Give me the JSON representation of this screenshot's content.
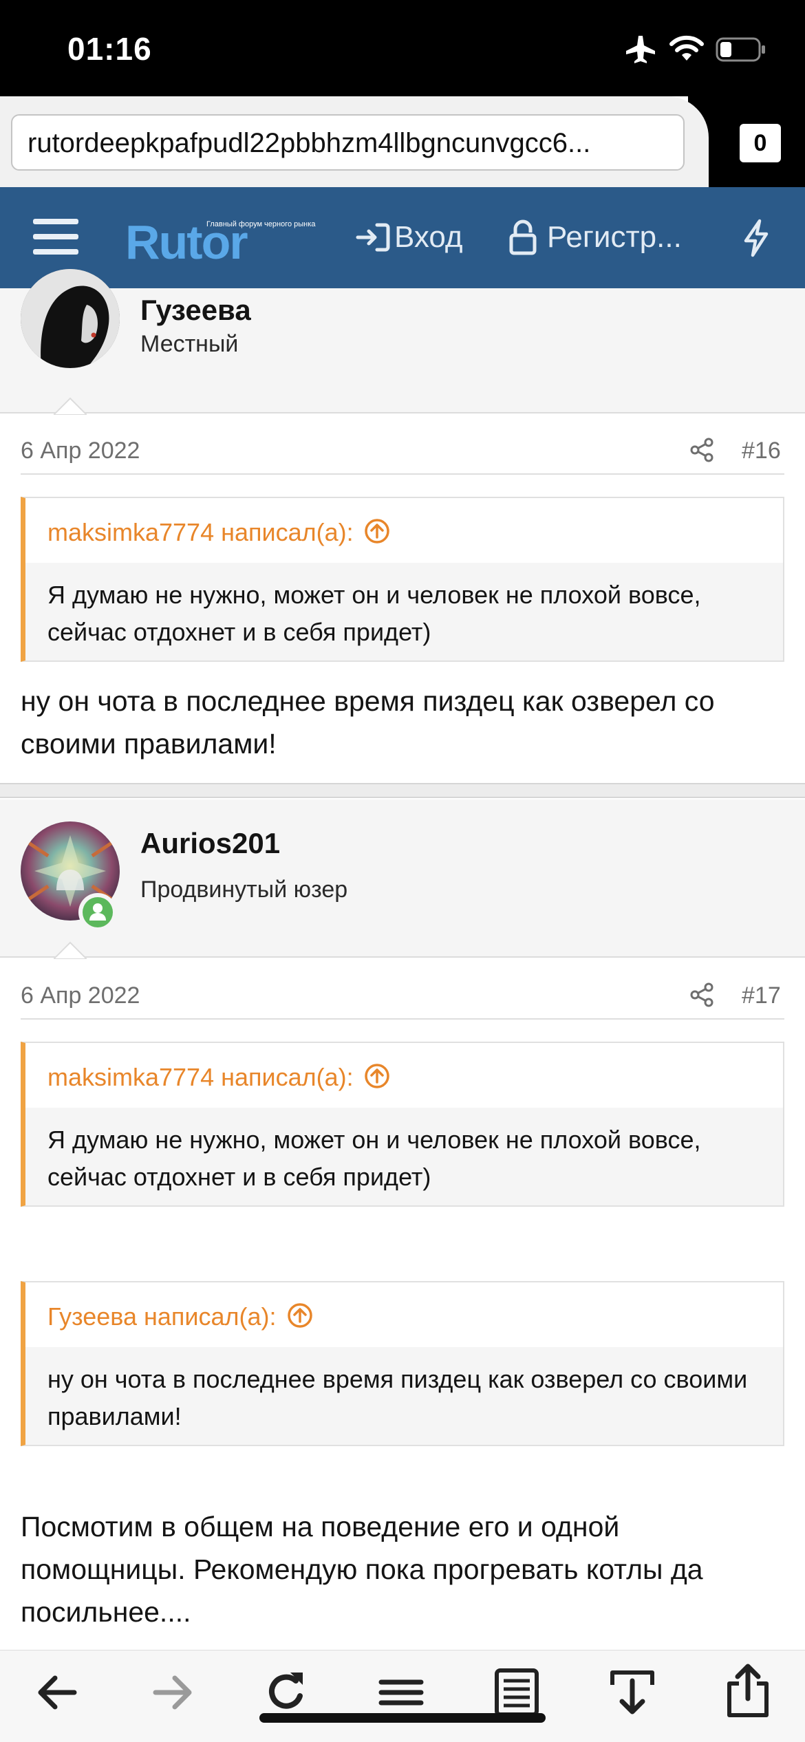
{
  "status_bar": {
    "time": "01:16"
  },
  "browser": {
    "url": "rutordeepkpafpudl22pbbhzm4llbgncunvgcc6...",
    "tab_count": "0"
  },
  "nav": {
    "logo": "Rutor",
    "logo_tagline": "Главный форум черного рынка",
    "login": "Вход",
    "register": "Регистр..."
  },
  "posts": [
    {
      "author": "Гузеева",
      "user_title": "Местный",
      "date": "6 Апр 2022",
      "number": "#16",
      "quotes": [
        {
          "header": "maksimka7774 написал(а):",
          "text": "Я думаю не нужно, может он и человек не плохой вовсе, сейчас отдохнет и в себя придет)"
        }
      ],
      "body": "ну он чота в последнее время пиздец как озверел со своими правилами!"
    },
    {
      "author": "Aurios201",
      "user_title": "Продвинутый юзер",
      "date": "6 Апр 2022",
      "number": "#17",
      "quotes": [
        {
          "header": "maksimka7774 написал(а):",
          "text": "Я думаю не нужно, может он и человек не плохой вовсе, сейчас отдохнет и в себя придет)"
        },
        {
          "header": "Гузеева написал(а):",
          "text": "ну он чота в последнее время пиздец как озверел со своими правилами!"
        }
      ],
      "body": "Посмотим в общем на поведение его и одной помощницы. Рекомендую пока прогревать котлы да посильнее...."
    }
  ],
  "colors": {
    "nav_bg": "#2b5a89",
    "logo_blue": "#5aa8e8",
    "quote_accent": "#f0a343",
    "quote_header": "#e8862a",
    "online_badge": "#5cb85c"
  },
  "icons": [
    "airplane-icon",
    "wifi-icon",
    "battery-icon",
    "menu-icon",
    "sign-in-icon",
    "lock-icon",
    "bolt-icon",
    "share-icon",
    "arrow-up-circle-icon",
    "back-icon",
    "forward-icon",
    "reload-icon",
    "menu-lines-icon",
    "reader-icon",
    "download-icon",
    "share-out-icon"
  ]
}
